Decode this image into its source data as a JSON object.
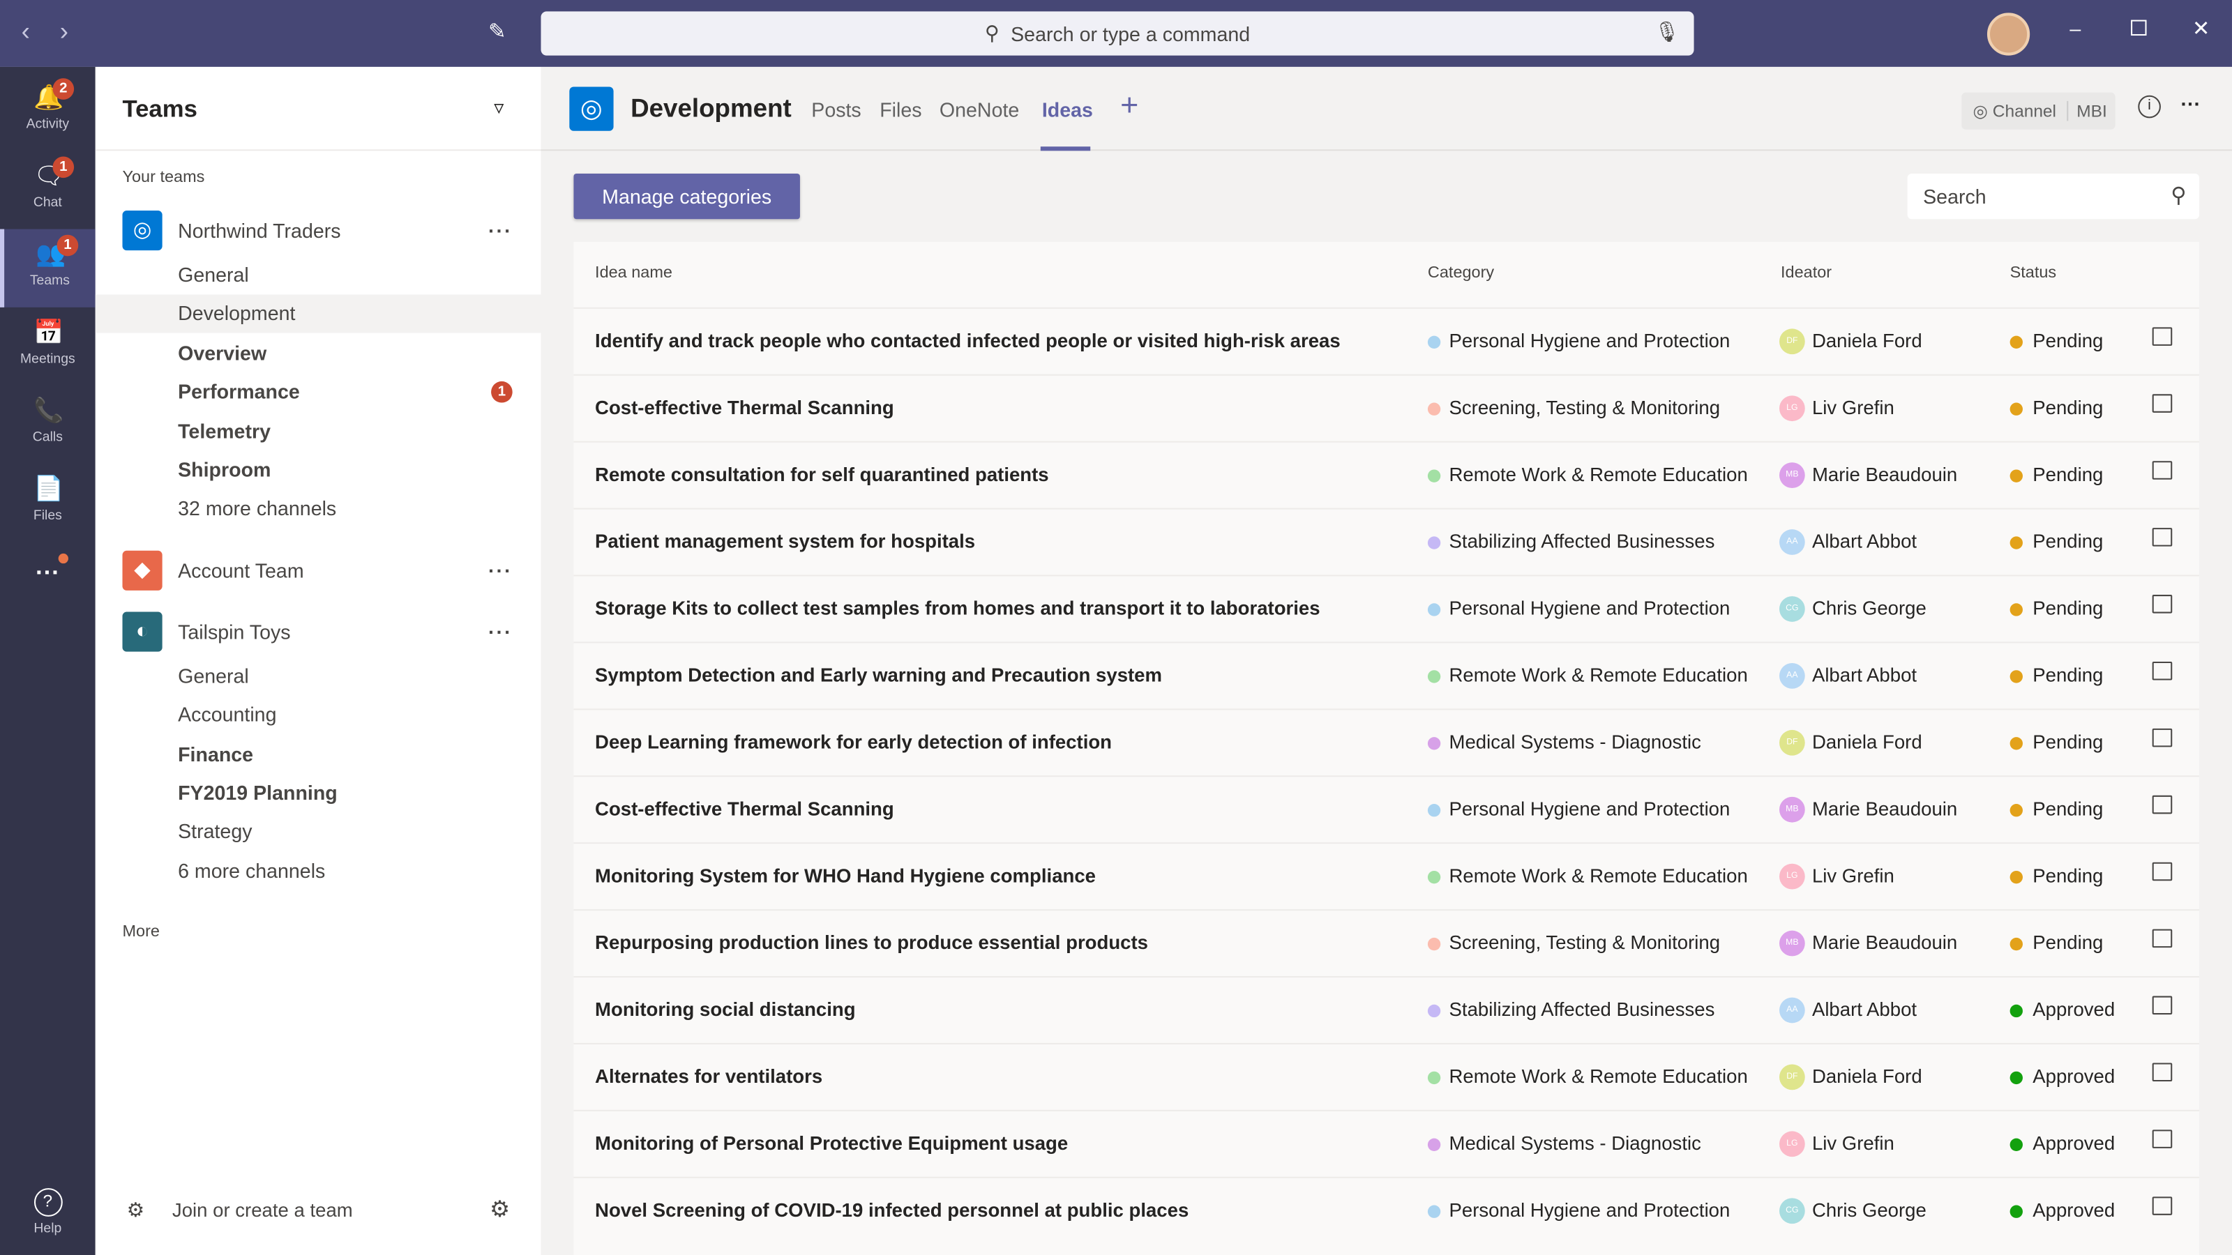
{
  "topbar": {
    "search_placeholder": "Search or type a command"
  },
  "rail": [
    {
      "label": "Activity",
      "icon": "bell-icon",
      "badge": "2"
    },
    {
      "label": "Chat",
      "icon": "chat-icon",
      "badge": "1"
    },
    {
      "label": "Teams",
      "icon": "teams-icon",
      "badge": "1"
    },
    {
      "label": "Meetings",
      "icon": "calendar-icon",
      "badge": ""
    },
    {
      "label": "Calls",
      "icon": "phone-icon",
      "badge": ""
    },
    {
      "label": "Files",
      "icon": "file-icon",
      "badge": ""
    },
    {
      "label": "Help",
      "icon": "help-icon",
      "badge": ""
    }
  ],
  "teams_pane": {
    "title": "Teams",
    "section": "Your teams",
    "more": "More",
    "join": "Join or create a team",
    "teams": [
      {
        "name": "Northwind Traders",
        "color": "#0078d4",
        "channels": [
          {
            "name": "General",
            "style": "normal"
          },
          {
            "name": "Development",
            "style": "selected"
          },
          {
            "name": "Overview",
            "style": "bold"
          },
          {
            "name": "Performance",
            "style": "bold",
            "badge": "1"
          },
          {
            "name": "Telemetry",
            "style": "muted"
          },
          {
            "name": "Shiproom",
            "style": "muted"
          },
          {
            "name": "32 more channels",
            "style": "link"
          }
        ]
      },
      {
        "name": "Account Team",
        "color": "#e8684a",
        "channels": []
      },
      {
        "name": "Tailspin Toys",
        "color": "#286a7a",
        "channels": [
          {
            "name": "General",
            "style": "normal"
          },
          {
            "name": "Accounting",
            "style": "normal"
          },
          {
            "name": "Finance",
            "style": "bold"
          },
          {
            "name": "FY2019 Planning",
            "style": "bold"
          },
          {
            "name": "Strategy",
            "style": "normal"
          },
          {
            "name": "6 more channels",
            "style": "link"
          }
        ]
      }
    ]
  },
  "header": {
    "channel": "Development",
    "tabs": [
      "Posts",
      "Files",
      "OneNote",
      "Ideas"
    ],
    "active_tab": "Ideas",
    "channel_label": "Channel",
    "mbi": "MBI"
  },
  "toolbar": {
    "manage": "Manage categories",
    "search_placeholder": "Search"
  },
  "table": {
    "headers": [
      "Idea name",
      "Category",
      "Ideator",
      "Status"
    ],
    "category_colors": {
      "Personal Hygiene and Protection": "#a9d3f0",
      "Screening, Testing & Monitoring": "#fbbcae",
      "Remote Work & Remote Education": "#a3e0a4",
      "Stabilizing Affected Businesses": "#c5b8f5",
      "Medical Systems - Diagnostic": "#d7a1e8"
    },
    "ideator_colors": {
      "DF": "#dfe58c",
      "LG": "#fbb9c8",
      "MB": "#dca0ea",
      "AA": "#b7d8f5",
      "CG": "#a8dde0"
    },
    "status_colors": {
      "Pending": "#e3a21a",
      "Approved": "#13a10e"
    },
    "rows": [
      {
        "name": "Identify and track people who contacted infected people or visited high-risk areas",
        "category": "Personal Hygiene and Protection",
        "ideator": "Daniela Ford",
        "initials": "DF",
        "status": "Pending"
      },
      {
        "name": "Cost-effective Thermal Scanning",
        "category": "Screening, Testing & Monitoring",
        "ideator": "Liv Grefin",
        "initials": "LG",
        "status": "Pending"
      },
      {
        "name": "Remote consultation for self quarantined patients",
        "category": "Remote Work & Remote Education",
        "ideator": "Marie Beaudouin",
        "initials": "MB",
        "status": "Pending"
      },
      {
        "name": "Patient management system for hospitals",
        "category": "Stabilizing Affected Businesses",
        "ideator": "Albart Abbot",
        "initials": "AA",
        "status": "Pending"
      },
      {
        "name": "Storage Kits to collect test samples from homes and transport it to laboratories",
        "category": "Personal Hygiene and Protection",
        "ideator": "Chris George",
        "initials": "CG",
        "status": "Pending"
      },
      {
        "name": "Symptom Detection and Early warning and Precaution system",
        "category": "Remote Work & Remote Education",
        "ideator": "Albart Abbot",
        "initials": "AA",
        "status": "Pending"
      },
      {
        "name": "Deep Learning framework for early detection of infection",
        "category": "Medical Systems - Diagnostic",
        "ideator": "Daniela Ford",
        "initials": "DF",
        "status": "Pending"
      },
      {
        "name": "Cost-effective Thermal Scanning",
        "category": "Personal Hygiene and Protection",
        "ideator": "Marie Beaudouin",
        "initials": "MB",
        "status": "Pending"
      },
      {
        "name": "Monitoring System for WHO Hand Hygiene compliance",
        "category": "Remote Work & Remote Education",
        "ideator": "Liv Grefin",
        "initials": "LG",
        "status": "Pending"
      },
      {
        "name": "Repurposing production lines to produce essential products",
        "category": "Screening, Testing & Monitoring",
        "ideator": "Marie Beaudouin",
        "initials": "MB",
        "status": "Pending"
      },
      {
        "name": "Monitoring social distancing",
        "category": "Stabilizing Affected Businesses",
        "ideator": "Albart Abbot",
        "initials": "AA",
        "status": "Approved"
      },
      {
        "name": "Alternates for ventilators",
        "category": "Remote Work & Remote Education",
        "ideator": "Daniela Ford",
        "initials": "DF",
        "status": "Approved"
      },
      {
        "name": "Monitoring of Personal Protective Equipment usage",
        "category": "Medical Systems - Diagnostic",
        "ideator": "Liv Grefin",
        "initials": "LG",
        "status": "Approved"
      },
      {
        "name": "Novel Screening of COVID-19 infected personnel at public places",
        "category": "Personal Hygiene and Protection",
        "ideator": "Chris George",
        "initials": "CG",
        "status": "Approved"
      }
    ]
  }
}
